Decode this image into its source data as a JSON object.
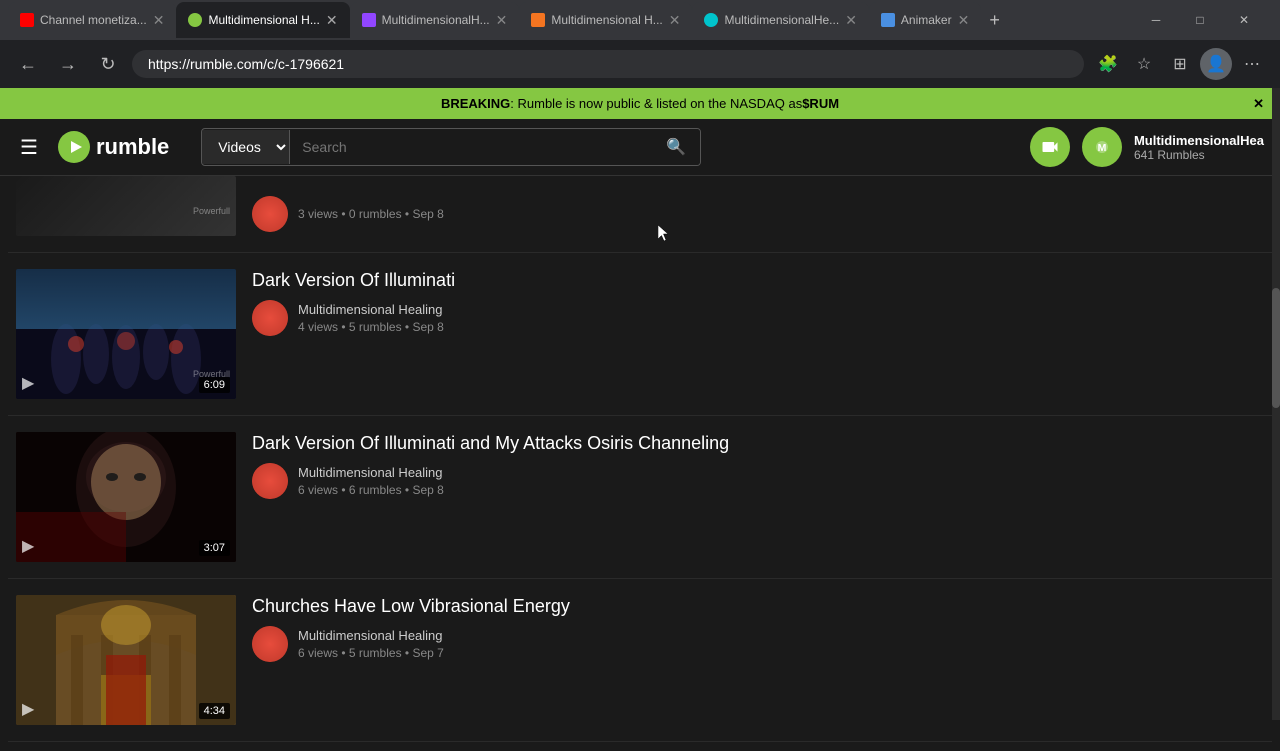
{
  "browser": {
    "tabs": [
      {
        "id": "yt",
        "favicon": "yt",
        "label": "Channel monetiza...",
        "active": false
      },
      {
        "id": "rumble1",
        "favicon": "rumble",
        "label": "Multidimensional H...",
        "active": true
      },
      {
        "id": "twitch",
        "favicon": "twitch",
        "label": "MultidimensionalH...",
        "active": false
      },
      {
        "id": "crunchyroll",
        "favicon": "crunchyroll",
        "label": "Multidimensional H...",
        "active": false
      },
      {
        "id": "canva",
        "favicon": "canva",
        "label": "MultidimensionalHe...",
        "active": false
      },
      {
        "id": "animaker",
        "favicon": "animaker",
        "label": "Animaker",
        "active": false
      }
    ],
    "address": "https://rumble.com/c/c-1796621",
    "window_controls": [
      "─",
      "□",
      "✕"
    ]
  },
  "banner": {
    "breaking_label": "BREAKING",
    "text": ": Rumble is now public & listed on the NASDAQ as ",
    "ticker": "$RUM"
  },
  "header": {
    "search_placeholder": "Search",
    "search_type": "Videos",
    "upload_icon": "📹",
    "username": "MultidimensionalHea",
    "rumble_count": "641 Rumbles"
  },
  "videos": {
    "partial": {
      "stats": "3 views • 0 rumbles • Sep 8",
      "duration": ""
    },
    "items": [
      {
        "title": "Dark Version Of Illuminati",
        "channel": "Multidimensional Healing",
        "stats": "4 views • 5 rumbles • Sep 8",
        "duration": "6:09",
        "thumb_class": "thumb-illuminati"
      },
      {
        "title": "Dark Version Of Illuminati and My Attacks Osiris Channeling",
        "channel": "Multidimensional Healing",
        "stats": "6 views • 6 rumbles • Sep 8",
        "duration": "3:07",
        "thumb_class": "thumb-osiris"
      },
      {
        "title": "Churches Have Low Vibrasional Energy",
        "channel": "Multidimensional Healing",
        "stats": "6 views • 5 rumbles • Sep 7",
        "duration": "4:34",
        "thumb_class": "thumb-churches"
      }
    ]
  }
}
